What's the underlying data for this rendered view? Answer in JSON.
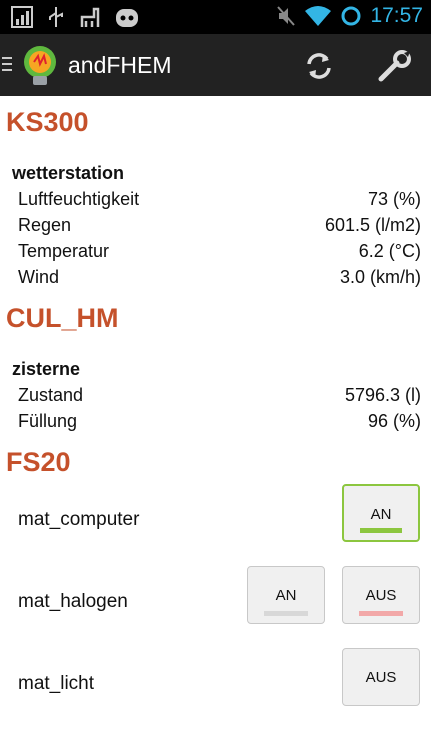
{
  "statusbar": {
    "time": "17:57"
  },
  "appbar": {
    "title": "andFHEM"
  },
  "sections": [
    {
      "title": "KS300",
      "device": "wetterstation",
      "rows": [
        {
          "label": "Luftfeuchtigkeit",
          "value": "73 (%)"
        },
        {
          "label": "Regen",
          "value": "601.5 (l/m2)"
        },
        {
          "label": "Temperatur",
          "value": "6.2 (°C)"
        },
        {
          "label": "Wind",
          "value": "3.0 (km/h)"
        }
      ]
    },
    {
      "title": "CUL_HM",
      "device": "zisterne",
      "rows": [
        {
          "label": "Zustand",
          "value": "5796.3 (l)"
        },
        {
          "label": "Füllung",
          "value": "96 (%)"
        }
      ]
    }
  ],
  "fs20": {
    "title": "FS20",
    "devices": [
      {
        "name": "mat_computer",
        "buttons": [
          {
            "label": "AN",
            "active": true
          }
        ]
      },
      {
        "name": "mat_halogen",
        "buttons": [
          {
            "label": "AN"
          },
          {
            "label": "AUS"
          }
        ]
      },
      {
        "name": "mat_licht",
        "buttons": [
          {
            "label": "AUS"
          }
        ]
      }
    ]
  },
  "colors": {
    "accent": "#c5512b",
    "on_bar_active": "#8cc63f",
    "on_bar": "#d8d8d8",
    "off_bar": "#f2a8a8",
    "time": "#33b5e5"
  }
}
